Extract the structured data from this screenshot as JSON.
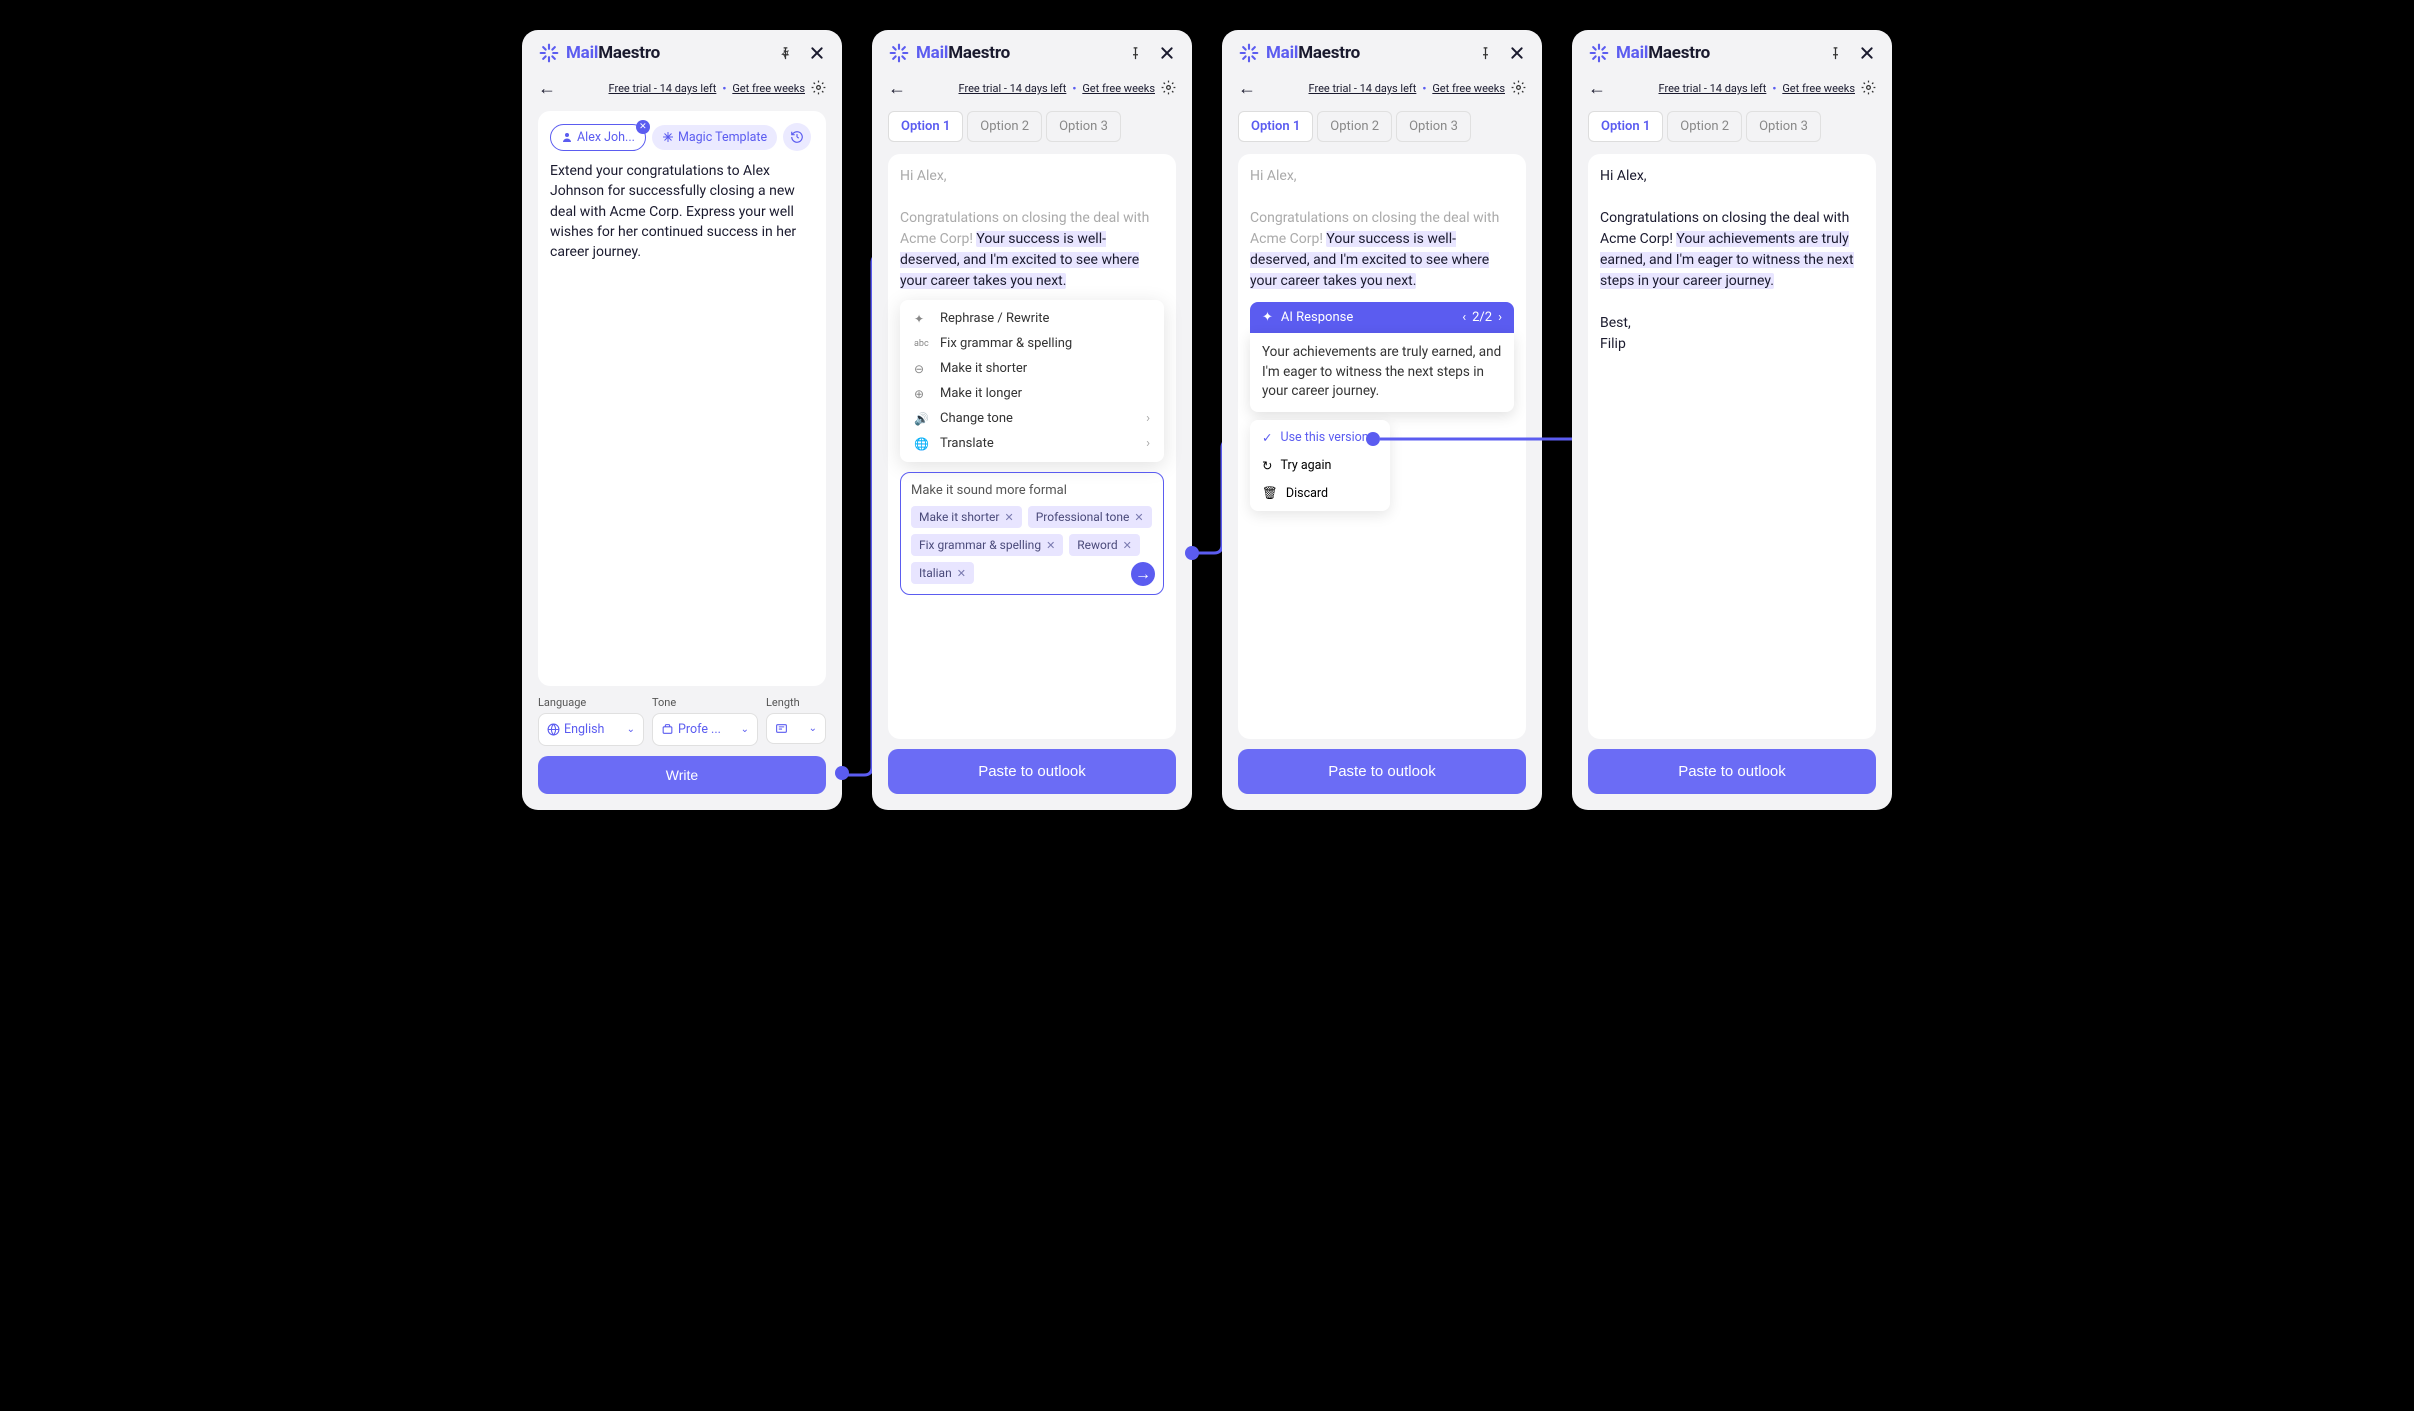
{
  "brand": {
    "mail": "Mail",
    "maestro": "Maestro"
  },
  "trial": {
    "text": "Free trial - 14 days left",
    "link": "Get free weeks"
  },
  "panel1": {
    "chip_person": "Alex Joh...",
    "chip_template": "Magic Template",
    "prompt": "Extend your congratulations to Alex Johnson for successfully closing a new deal with Acme Corp. Express your well wishes for her continued success in her career journey.",
    "control_language_label": "Language",
    "control_language_value": "English",
    "control_tone_label": "Tone",
    "control_tone_value": "Profe ...",
    "control_length_label": "Length",
    "write_button": "Write"
  },
  "tabs": [
    "Option 1",
    "Option 2",
    "Option 3"
  ],
  "panel2": {
    "greeting": "Hi Alex,",
    "body_prefix": "Congratulations on closing the deal with Acme Corp! ",
    "body_highlight": "Your success is well-deserved, and I'm excited to see where your career takes you next.",
    "menu": {
      "rephrase": "Rephrase / Rewrite",
      "grammar": "Fix grammar & spelling",
      "shorter": "Make it shorter",
      "longer": "Make it longer",
      "tone": "Change tone",
      "translate": "Translate"
    },
    "suggest_input": "Make it sound more formal",
    "tags": [
      "Make it shorter",
      "Professional tone",
      "Fix grammar & spelling",
      "Reword",
      "Italian"
    ],
    "paste_button": "Paste to outlook"
  },
  "panel3": {
    "greeting": "Hi Alex,",
    "body_prefix": "Congratulations on closing the deal with Acme Corp! ",
    "body_highlight": "Your success is well-deserved, and I'm excited to see where your career takes you next.",
    "ai_label": "AI Response",
    "ai_pager": "2/2",
    "ai_body": "Your achievements are truly earned, and I'm eager to witness the next steps in your career journey.",
    "actions": {
      "use": "Use this version",
      "retry": "Try again",
      "discard": "Discard"
    },
    "paste_button": "Paste to outlook"
  },
  "panel4": {
    "greeting": "Hi Alex,",
    "body_prefix": "Congratulations on closing the deal with Acme Corp! ",
    "body_highlight": "Your achievements are truly earned, and I'm eager to witness the next steps in your career journey.",
    "signoff1": "Best,",
    "signoff2": "Filip",
    "paste_button": "Paste to outlook"
  }
}
